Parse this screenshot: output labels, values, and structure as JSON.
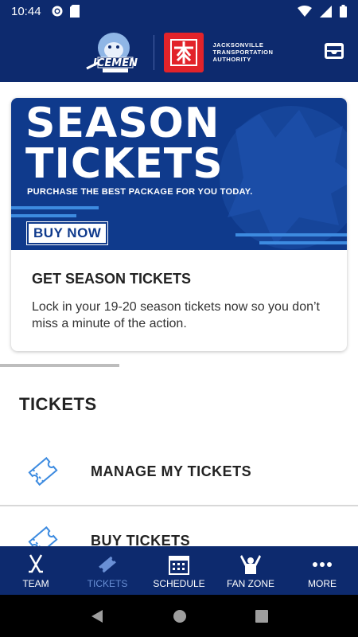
{
  "status_bar": {
    "time": "10:44"
  },
  "header": {
    "team_logo_text": "ICEMEN",
    "partner_name": "JACKSONVILLE TRANSPORTATION AUTHORITY",
    "partner_lines": [
      "JACKSONVILLE",
      "TRANSPORTATION",
      "AUTHORITY"
    ]
  },
  "promo_card": {
    "banner_line1": "SEASON",
    "banner_line2": "TICKETS",
    "banner_sub": "PURCHASE THE BEST PACKAGE FOR YOU TODAY.",
    "banner_button": "BUY NOW",
    "title": "GET SEASON TICKETS",
    "description": "Lock in your 19-20 season tickets now so you don’t miss a minute of the action."
  },
  "tickets_section": {
    "title": "TICKETS",
    "items": [
      {
        "label": "MANAGE MY TICKETS",
        "icon": "ticket-icon"
      },
      {
        "label": "BUY TICKETS",
        "icon": "ticket-icon"
      }
    ]
  },
  "tabs": [
    {
      "label": "TEAM",
      "icon": "hockey-sticks-icon",
      "active": false
    },
    {
      "label": "TICKETS",
      "icon": "ticket-icon",
      "active": true
    },
    {
      "label": "SCHEDULE",
      "icon": "calendar-icon",
      "active": false
    },
    {
      "label": "FAN ZONE",
      "icon": "fan-icon",
      "active": false
    },
    {
      "label": "MORE",
      "icon": "more-icon",
      "active": false
    }
  ],
  "colors": {
    "navy": "#0d2a6e",
    "banner_blue": "#0f3a8c",
    "accent_blue": "#3d8be0",
    "active_tab": "#6a90d6",
    "jta_red": "#e2232a"
  }
}
